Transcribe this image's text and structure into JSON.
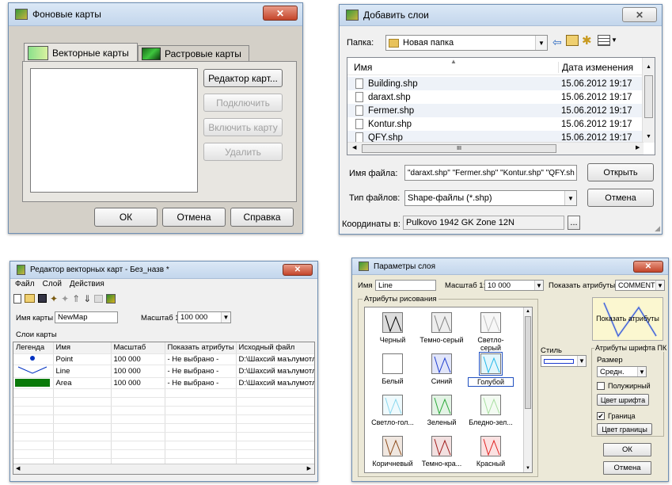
{
  "w1": {
    "title": "Фоновые карты",
    "tab_vector": "Векторные карты",
    "tab_raster": "Растровые карты",
    "btn_editor": "Редактор карт...",
    "btn_connect": "Подключить",
    "btn_enable": "Включить карту",
    "btn_delete": "Удалить",
    "btn_ok": "ОК",
    "btn_cancel": "Отмена",
    "btn_help": "Справка"
  },
  "w2": {
    "title": "Добавить слои",
    "folder_label": "Папка:",
    "folder_value": "Новая папка",
    "col_name": "Имя",
    "col_date": "Дата изменения",
    "files": [
      {
        "name": "Building.shp",
        "date": "15.06.2012 19:17"
      },
      {
        "name": "daraxt.shp",
        "date": "15.06.2012 19:17"
      },
      {
        "name": "Fermer.shp",
        "date": "15.06.2012 19:17"
      },
      {
        "name": "Kontur.shp",
        "date": "15.06.2012 19:17"
      },
      {
        "name": "QFY.shp",
        "date": "15.06.2012 19:17"
      }
    ],
    "filename_label": "Имя файла:",
    "filename_value": "\"daraxt.shp\" \"Fermer.shp\" \"Kontur.shp\" \"QFY.sh",
    "filetype_label": "Тип файлов:",
    "filetype_value": "Shape-файлы (*.shp)",
    "btn_open": "Открыть",
    "btn_cancel": "Отмена",
    "coords_label": "Координаты в:",
    "coords_value": "Pulkovo 1942 GK Zone 12N",
    "coords_btn": "...",
    "hscroll_mark": "III"
  },
  "w3": {
    "title": "Редактор векторных карт - Без_назв *",
    "menu": [
      "Файл",
      "Слой",
      "Действия"
    ],
    "map_name_label": "Имя карты",
    "map_name_value": "NewMap",
    "scale_label": "Масштаб 1:",
    "scale_value": "100 000",
    "layers_label": "Слои карты",
    "cols": [
      "Легенда",
      "Имя",
      "Масштаб",
      "Показать атрибуты",
      "Исходный файл"
    ],
    "rows": [
      {
        "name": "Point",
        "scale": "100 000",
        "attr": "- Не выбрано -",
        "file": "D:\\Шахсий маълумотлар"
      },
      {
        "name": "Line",
        "scale": "100 000",
        "attr": "- Не выбрано -",
        "file": "D:\\Шахсий маълумотлар"
      },
      {
        "name": "Area",
        "scale": "100 000",
        "attr": "- Не выбрано -",
        "file": "D:\\Шахсий маълумотлар"
      }
    ]
  },
  "w4": {
    "title": "Параметры слоя",
    "name_label": "Имя",
    "name_value": "Line",
    "scale_label": "Масштаб 1:",
    "scale_value": "10 000",
    "show_attr_label": "Показать атрибуты",
    "show_attr_value": "COMMENT",
    "draw_group": "Атрибуты рисования",
    "swatches": [
      {
        "label": "Черный",
        "color": "#000000"
      },
      {
        "label": "Темно-серый",
        "color": "#808080"
      },
      {
        "label": "Светло-серый",
        "color": "#c0c0c0"
      },
      {
        "label": "Белый",
        "color": "#ffffff"
      },
      {
        "label": "Синий",
        "color": "#1e3ccf"
      },
      {
        "label": "Голубой",
        "color": "#22b8e8"
      },
      {
        "label": "Светло-гол...",
        "color": "#8ad8ee"
      },
      {
        "label": "Зеленый",
        "color": "#2aa83a"
      },
      {
        "label": "Бледно-зел...",
        "color": "#a8dfa0"
      },
      {
        "label": "Коричневый",
        "color": "#8b4a1a"
      },
      {
        "label": "Темно-кра...",
        "color": "#9e1a1a"
      },
      {
        "label": "Красный",
        "color": "#e02020"
      }
    ],
    "style_label": "Стиль",
    "preview_label": "Показать атрибуты",
    "font_group": "Атрибуты шрифта ПК",
    "size_label": "Размер",
    "size_value": "Средн.",
    "bold_label": "Полужирный",
    "font_color_btn": "Цвет шрифта",
    "border_label": "Граница",
    "border_color_btn": "Цвет границы",
    "ok": "ОК",
    "cancel": "Отмена"
  }
}
